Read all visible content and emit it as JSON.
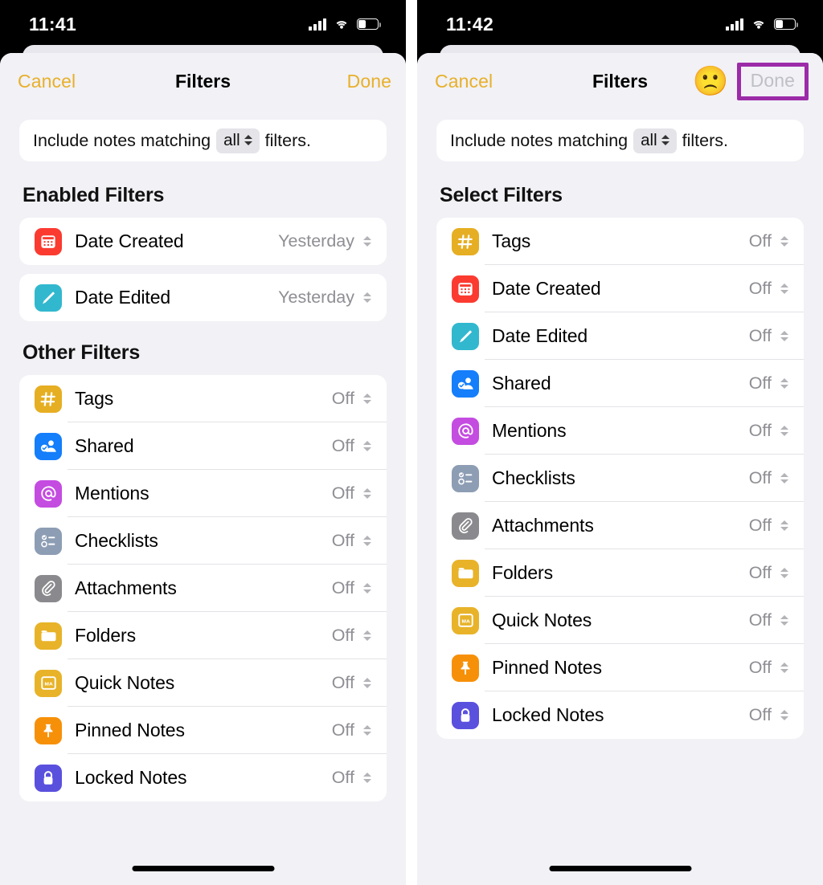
{
  "panels": [
    {
      "status": {
        "time": "11:41",
        "signal_icon": "cellular-signal-icon",
        "wifi_icon": "wifi-icon",
        "battery_icon": "battery-icon"
      },
      "nav": {
        "cancel_label": "Cancel",
        "title": "Filters",
        "done_label": "Done",
        "done_disabled": false,
        "has_emoji": false,
        "done_highlighted": false
      },
      "match": {
        "prefix": "Include notes matching",
        "selected": "all",
        "suffix": "filters."
      },
      "sections": [
        {
          "heading": "Enabled Filters",
          "style": "separate-cards",
          "rows": [
            {
              "label": "Date Created",
              "value": "Yesterday",
              "icon": "calendar-icon",
              "icon_color": "#FB3B30"
            },
            {
              "label": "Date Edited",
              "value": "Yesterday",
              "icon": "pencil-icon",
              "icon_color": "#32B8CE"
            }
          ]
        },
        {
          "heading": "Other Filters",
          "style": "grouped-card",
          "rows": [
            {
              "label": "Tags",
              "value": "Off",
              "icon": "hashtag-icon",
              "icon_color": "#E6AE22"
            },
            {
              "label": "Shared",
              "value": "Off",
              "icon": "shared-person-icon",
              "icon_color": "#147EFB"
            },
            {
              "label": "Mentions",
              "value": "Off",
              "icon": "at-sign-icon",
              "icon_color": "#C44CE0"
            },
            {
              "label": "Checklists",
              "value": "Off",
              "icon": "checklist-icon",
              "icon_color": "#8D9DB4"
            },
            {
              "label": "Attachments",
              "value": "Off",
              "icon": "paperclip-icon",
              "icon_color": "#8A8A8E"
            },
            {
              "label": "Folders",
              "value": "Off",
              "icon": "folder-icon",
              "icon_color": "#E8B329"
            },
            {
              "label": "Quick Notes",
              "value": "Off",
              "icon": "quick-note-icon",
              "icon_color": "#E8B329"
            },
            {
              "label": "Pinned Notes",
              "value": "Off",
              "icon": "pin-icon",
              "icon_color": "#F79009"
            },
            {
              "label": "Locked Notes",
              "value": "Off",
              "icon": "lock-icon",
              "icon_color": "#5A50DE"
            }
          ]
        }
      ]
    },
    {
      "status": {
        "time": "11:42",
        "signal_icon": "cellular-signal-icon",
        "wifi_icon": "wifi-icon",
        "battery_icon": "battery-icon"
      },
      "nav": {
        "cancel_label": "Cancel",
        "title": "Filters",
        "done_label": "Done",
        "done_disabled": true,
        "has_emoji": true,
        "emoji": "🙁",
        "emoji_name": "sad-face-emoji",
        "done_highlighted": true,
        "highlight_color": "#9C2BA8"
      },
      "match": {
        "prefix": "Include notes matching",
        "selected": "all",
        "suffix": "filters."
      },
      "sections": [
        {
          "heading": "Select Filters",
          "style": "grouped-card",
          "rows": [
            {
              "label": "Tags",
              "value": "Off",
              "icon": "hashtag-icon",
              "icon_color": "#E6AE22"
            },
            {
              "label": "Date Created",
              "value": "Off",
              "icon": "calendar-icon",
              "icon_color": "#FB3B30"
            },
            {
              "label": "Date Edited",
              "value": "Off",
              "icon": "pencil-icon",
              "icon_color": "#32B8CE"
            },
            {
              "label": "Shared",
              "value": "Off",
              "icon": "shared-person-icon",
              "icon_color": "#147EFB"
            },
            {
              "label": "Mentions",
              "value": "Off",
              "icon": "at-sign-icon",
              "icon_color": "#C44CE0"
            },
            {
              "label": "Checklists",
              "value": "Off",
              "icon": "checklist-icon",
              "icon_color": "#8D9DB4"
            },
            {
              "label": "Attachments",
              "value": "Off",
              "icon": "paperclip-icon",
              "icon_color": "#8A8A8E"
            },
            {
              "label": "Folders",
              "value": "Off",
              "icon": "folder-icon",
              "icon_color": "#E8B329"
            },
            {
              "label": "Quick Notes",
              "value": "Off",
              "icon": "quick-note-icon",
              "icon_color": "#E8B329"
            },
            {
              "label": "Pinned Notes",
              "value": "Off",
              "icon": "pin-icon",
              "icon_color": "#F79009"
            },
            {
              "label": "Locked Notes",
              "value": "Off",
              "icon": "lock-icon",
              "icon_color": "#5A50DE"
            }
          ]
        }
      ]
    }
  ],
  "theme": {
    "accent": "#E8B02A",
    "sheet_bg": "#F1F1F6",
    "card_bg": "#FFFFFF",
    "value_grey": "#8E8E94",
    "highlight": "#9C2BA8"
  }
}
